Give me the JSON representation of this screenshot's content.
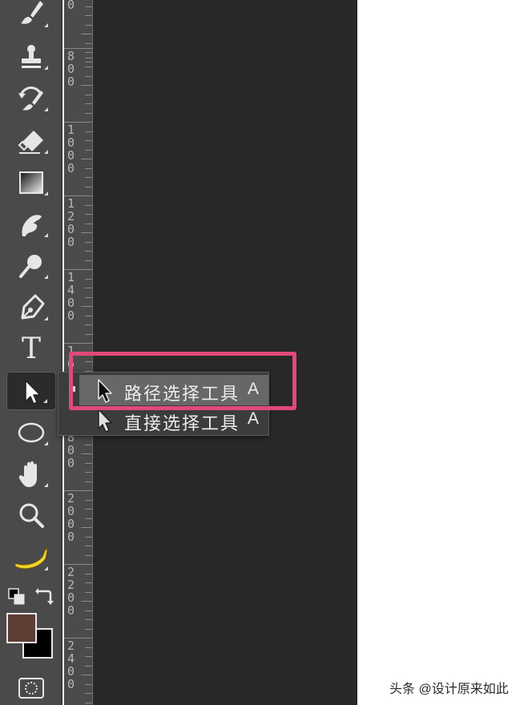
{
  "tools": [
    {
      "name": "brush-tool",
      "icon": "brush-icon"
    },
    {
      "name": "clone-stamp-tool",
      "icon": "stamp-icon"
    },
    {
      "name": "history-brush-tool",
      "icon": "history-brush-icon"
    },
    {
      "name": "eraser-tool",
      "icon": "eraser-icon"
    },
    {
      "name": "gradient-tool",
      "icon": "gradient-icon"
    },
    {
      "name": "smudge-tool",
      "icon": "smudge-icon"
    },
    {
      "name": "dodge-tool",
      "icon": "dodge-icon"
    },
    {
      "name": "pen-tool",
      "icon": "pen-icon"
    },
    {
      "name": "type-tool",
      "icon": "type-icon"
    },
    {
      "name": "path-selection-tool",
      "icon": "arrow-cursor-icon",
      "active": true
    },
    {
      "name": "ellipse-tool",
      "icon": "ellipse-icon"
    },
    {
      "name": "hand-tool",
      "icon": "hand-icon"
    },
    {
      "name": "zoom-tool",
      "icon": "magnifier-icon"
    },
    {
      "name": "banana-tool",
      "icon": "banana-icon"
    }
  ],
  "type_tool_glyph": "T",
  "ruler": {
    "labels": [
      "0",
      "800",
      "1000",
      "1200",
      "1400",
      "1600",
      "1800",
      "2000",
      "2200",
      "2400"
    ]
  },
  "flyout": {
    "items": [
      {
        "label": "路径选择工具",
        "shortcut": "A",
        "selected": true
      },
      {
        "label": "直接选择工具",
        "shortcut": "A",
        "selected": false
      }
    ]
  },
  "colors": {
    "foreground": "#5e3d34",
    "background": "#000000",
    "highlight": "#e04a78"
  },
  "watermark": "头条 @设计原来如此"
}
